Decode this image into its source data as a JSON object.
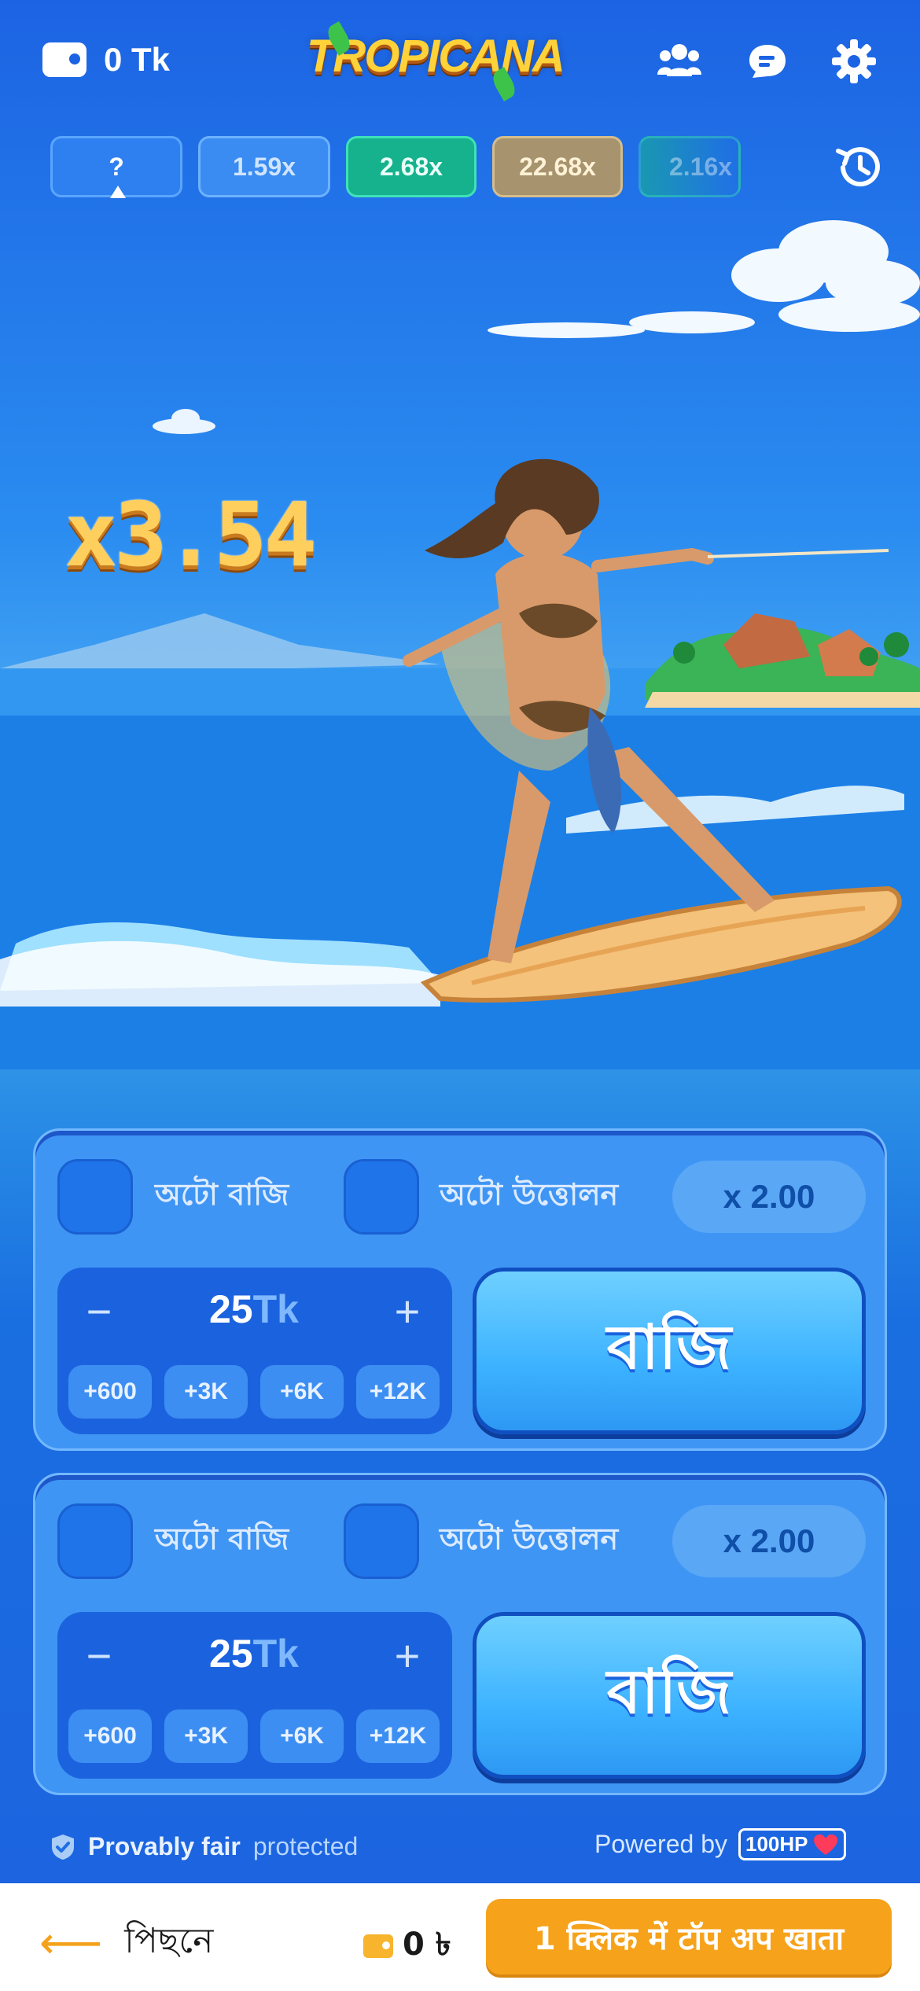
{
  "header": {
    "balance": "0 Tk",
    "logo_text": "TROPICANA",
    "icons": [
      "wallet-icon",
      "players-icon",
      "chat-icon",
      "gear-icon",
      "history-icon"
    ]
  },
  "history": {
    "current": "?",
    "items": [
      "1.59x",
      "2.68x",
      "22.68x",
      "2.16x"
    ]
  },
  "game": {
    "multiplier": "x3.54"
  },
  "panels": [
    {
      "auto_bet_label": "অটো বাজি",
      "auto_cashout_label": "অটো উত্তোলন",
      "cashout_multiplier": "x 2.00",
      "minus": "−",
      "plus": "+",
      "amount": "25",
      "unit": "Tk",
      "quick": [
        "+600",
        "+3K",
        "+6K",
        "+12K"
      ],
      "bet_label": "বাজি"
    },
    {
      "auto_bet_label": "অটো বাজি",
      "auto_cashout_label": "অটো উত্তোলন",
      "cashout_multiplier": "x 2.00",
      "minus": "−",
      "plus": "+",
      "amount": "25",
      "unit": "Tk",
      "quick": [
        "+600",
        "+3K",
        "+6K",
        "+12K"
      ],
      "bet_label": "বাজি"
    }
  ],
  "footer": {
    "fair_strong": "Provably fair",
    "fair_weak": "protected",
    "powered_by": "Powered by",
    "provider": "100HP"
  },
  "bottombar": {
    "back_label": "পিছনে",
    "mini_balance": "0 ৳",
    "topup_label": "1 क्लिक में टॉप अप खाता"
  },
  "colors": {
    "accent_orange": "#f6a21b",
    "panel_blue": "#3f95f4",
    "chip_green": "#15b28d",
    "chip_gold": "#a7936d"
  }
}
